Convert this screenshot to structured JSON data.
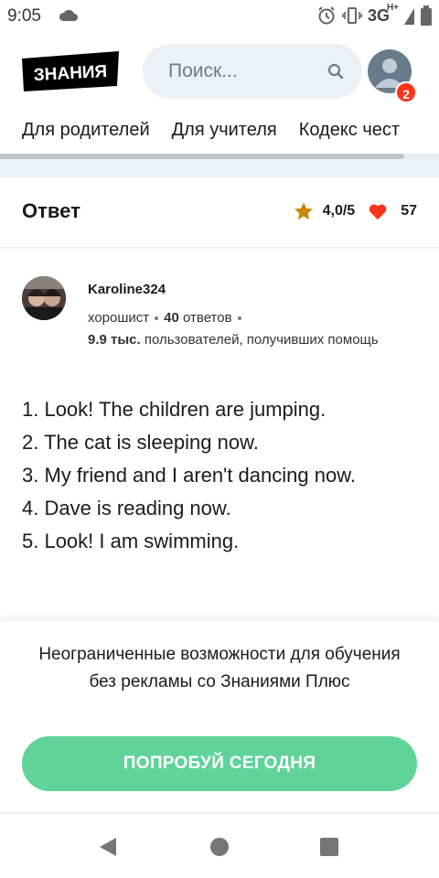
{
  "status_bar": {
    "time": "9:05",
    "network": "3G",
    "network_sup": "H+"
  },
  "header": {
    "logo_text": "ЗНАНИЯ",
    "search_placeholder": "Поиск...",
    "notification_count": "2"
  },
  "nav": {
    "tabs": [
      "Для родителей",
      "Для учителя",
      "Кодекс чест"
    ]
  },
  "answer": {
    "title": "Ответ",
    "rating": "4,0/5",
    "likes": "57",
    "author": {
      "name": "Karoline324",
      "rank": "хорошист",
      "answers_count": "40",
      "answers_label": "ответов",
      "helped_count": "9.9 тыс.",
      "helped_label": "пользователей, получивших помощь"
    },
    "lines": [
      "1. Look! The children are jumping.",
      "2. The cat is sleeping now.",
      "3. My friend and I aren't dancing now.",
      "4. Dave is reading now.",
      "5. Look! I am swimming."
    ]
  },
  "promo": {
    "text": "Неограниченные возможности для обучения без рекламы со Знаниями Плюс",
    "cta": "ПОПРОБУЙ СЕГОДНЯ"
  },
  "colors": {
    "accent_green": "#60d399",
    "badge_red": "#ff341a",
    "star": "#c98600",
    "heart": "#ff341a",
    "search_bg": "#ebf2f7"
  }
}
